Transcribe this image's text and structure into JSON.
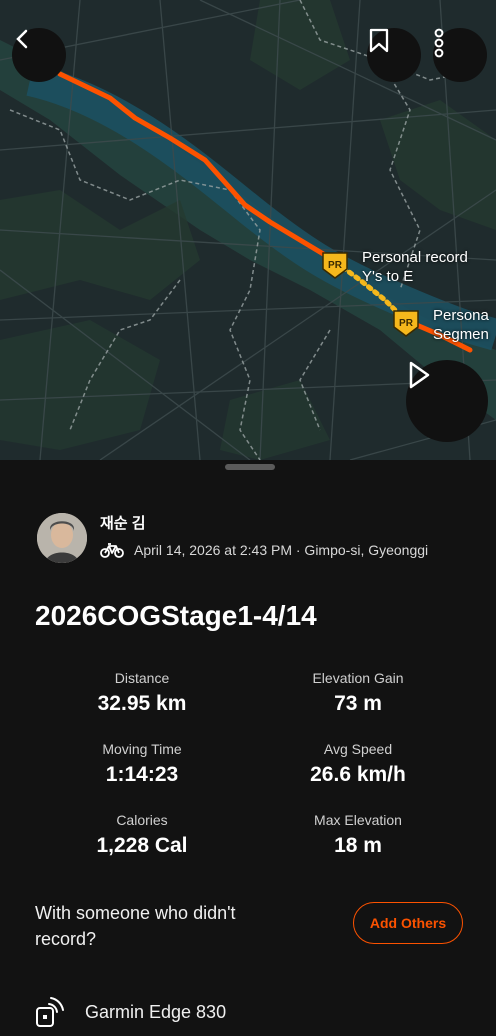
{
  "map": {
    "pr_labels": [
      {
        "line1": "Personal record",
        "line2": "Y's   to   E"
      },
      {
        "line1": "Persona",
        "line2": "Segmen"
      }
    ],
    "badge_text": "PR"
  },
  "activity": {
    "athlete_name": "재순 김",
    "date_prefix": "April",
    "date_rest": "14, 2026 at 2:43 PM · Gimpo-si, Gyeonggi",
    "title": "2026COGStage1-4/14"
  },
  "stats": {
    "distance": {
      "label": "Distance",
      "value": "32.95 km"
    },
    "elevation_gain": {
      "label": "Elevation Gain",
      "value": "73 m"
    },
    "moving_time": {
      "label": "Moving Time",
      "value": "1:14:23"
    },
    "avg_speed": {
      "label": "Avg Speed",
      "value": "26.6 km/h"
    },
    "calories": {
      "label": "Calories",
      "value": "1,228 Cal"
    },
    "max_elevation": {
      "label": "Max Elevation",
      "value": "18 m"
    }
  },
  "others": {
    "prompt": "With someone who didn't record?",
    "button_label": "Add Others"
  },
  "device": {
    "name": "Garmin Edge 830",
    "icon": "device-sync-icon"
  },
  "colors": {
    "accent": "#fc5200",
    "route": "#fc5200",
    "pr_gold": "#f5b81c",
    "background": "#121212"
  }
}
